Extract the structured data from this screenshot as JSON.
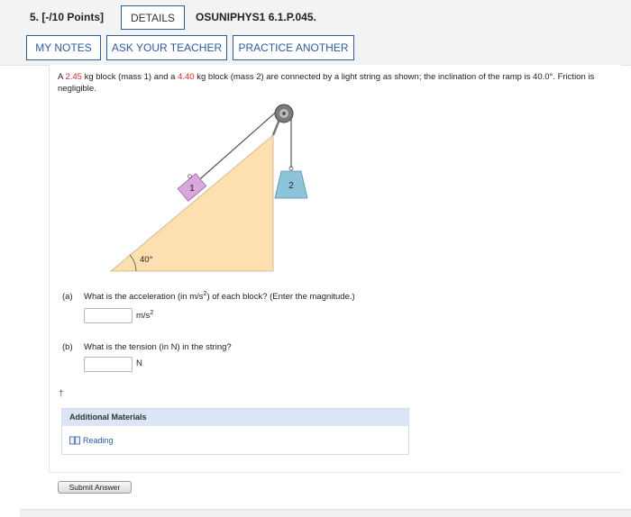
{
  "header": {
    "question_number": "5. [-/10 Points]",
    "details_label": "DETAILS",
    "question_code": "OSUNIPHYS1 6.1.P.045."
  },
  "actions": {
    "my_notes": "MY NOTES",
    "ask_teacher": "ASK YOUR TEACHER",
    "practice_another": "PRACTICE ANOTHER"
  },
  "problem": {
    "part1": "A ",
    "mass1": "2.45",
    "part2": " kg block (mass 1) and a ",
    "mass2": "4.40",
    "part3": " kg block (mass 2) are connected by a light string as shown; the inclination of the ramp is 40.0°. Friction is negligible."
  },
  "figure": {
    "angle_label": "40°",
    "block1_label": "1",
    "block2_label": "2"
  },
  "part_a": {
    "label": "(a)",
    "question_pre": "What is the acceleration (in m/s",
    "question_sup": "2",
    "question_post": ") of each block? (Enter the magnitude.)",
    "input_value": "",
    "unit_base": "m/s",
    "unit_sup": "2"
  },
  "part_b": {
    "label": "(b)",
    "question": "What is the tension (in N) in the string?",
    "input_value": "",
    "unit": "N"
  },
  "dagger": "†",
  "materials": {
    "header": "Additional Materials",
    "reading": "Reading"
  },
  "submit_label": "Submit Answer",
  "colors": {
    "accent": "#2b5d9f",
    "highlight": "#d62a2a",
    "ramp": "#fddfb0",
    "block1": "#d9a6dd",
    "block2": "#8dc4dc"
  }
}
